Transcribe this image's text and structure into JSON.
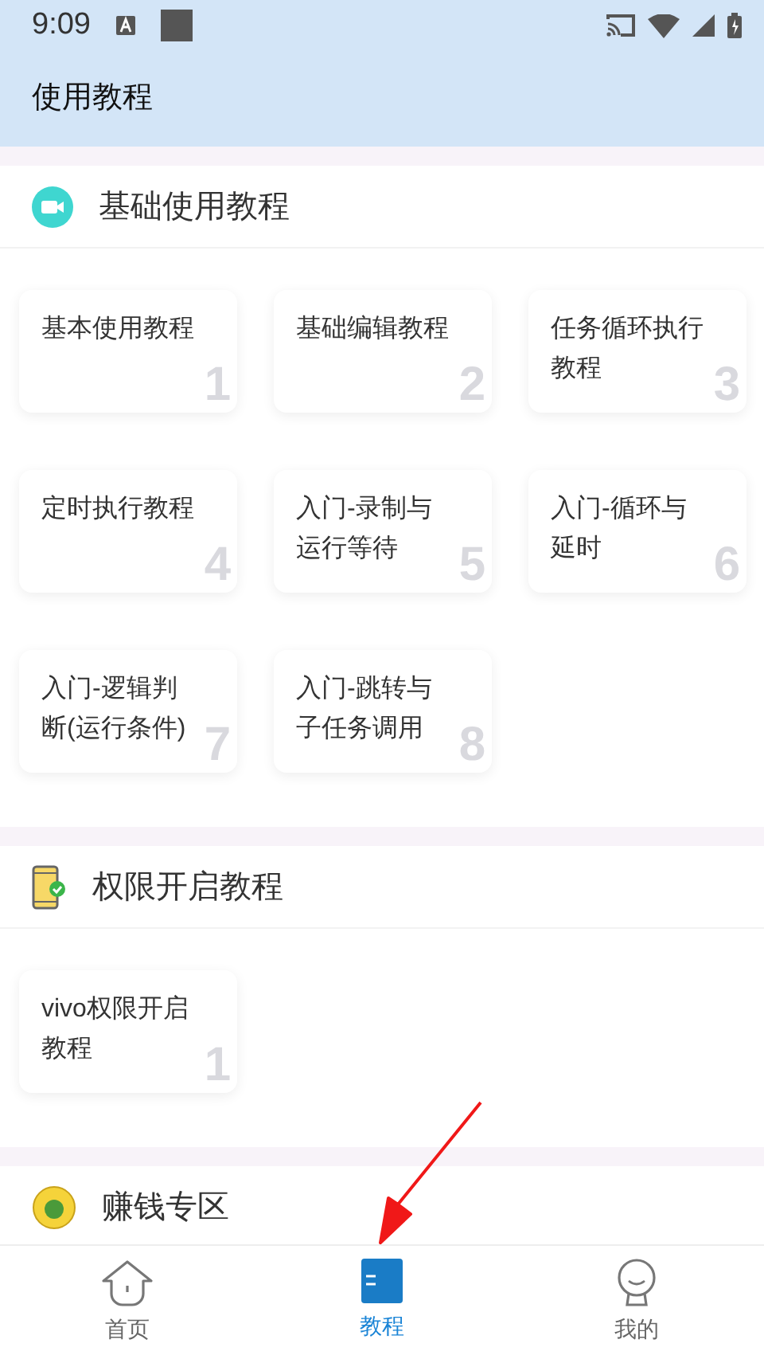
{
  "status_bar": {
    "time": "9:09"
  },
  "app_bar": {
    "title": "使用教程"
  },
  "sections": [
    {
      "title": "基础使用教程",
      "cards": [
        {
          "title": "基本使用教程",
          "number": "1"
        },
        {
          "title": "基础编辑教程",
          "number": "2"
        },
        {
          "title": "任务循环执行教程",
          "number": "3"
        },
        {
          "title": "定时执行教程",
          "number": "4"
        },
        {
          "title": "入门-录制与运行等待",
          "number": "5"
        },
        {
          "title": "入门-循环与延时",
          "number": "6"
        },
        {
          "title": "入门-逻辑判断(运行条件)",
          "number": "7"
        },
        {
          "title": "入门-跳转与子任务调用",
          "number": "8"
        }
      ]
    },
    {
      "title": "权限开启教程",
      "cards": [
        {
          "title": "vivo权限开启教程",
          "number": "1"
        }
      ]
    },
    {
      "title": "赚钱专区"
    }
  ],
  "tab_bar": [
    {
      "label": "首页",
      "selected": false
    },
    {
      "label": "教程",
      "selected": true
    },
    {
      "label": "我的",
      "selected": false
    }
  ]
}
